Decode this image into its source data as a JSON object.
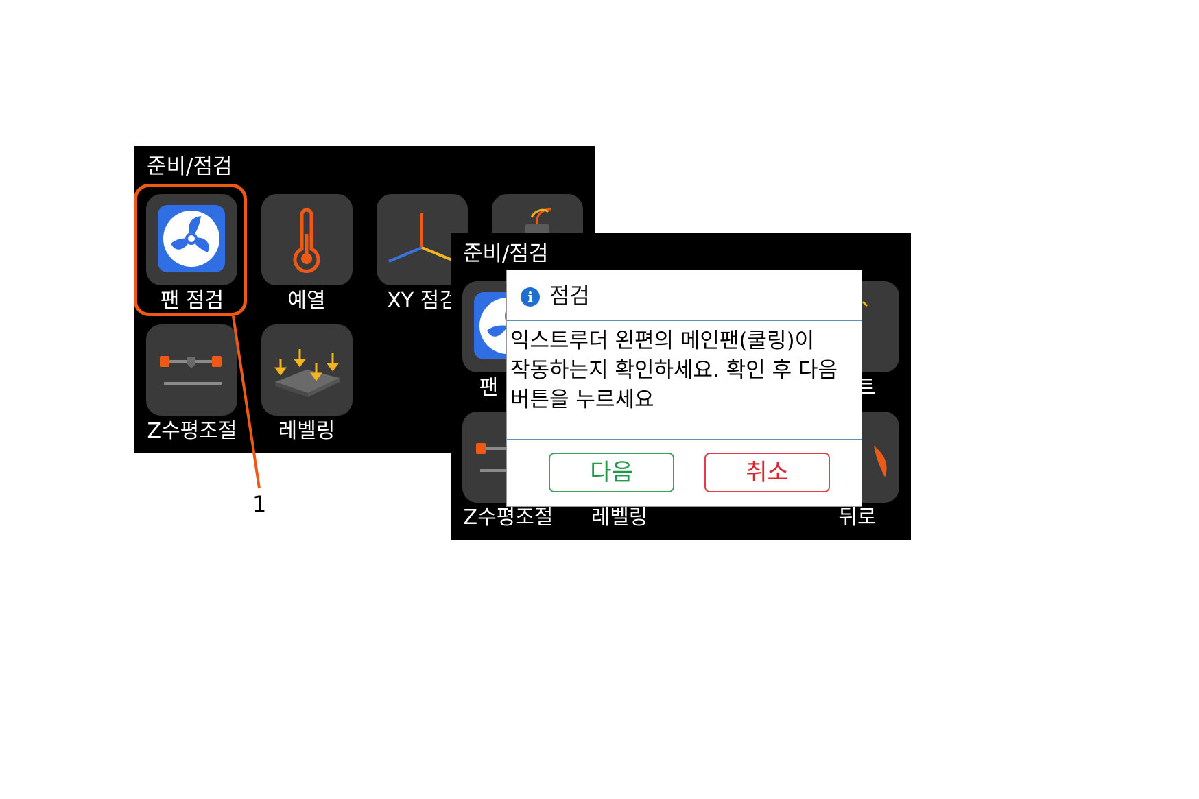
{
  "screen1": {
    "title": "준비/점검",
    "tiles": [
      {
        "label": "팬 점검",
        "icon": "fan-icon"
      },
      {
        "label": "예열",
        "icon": "thermometer-icon"
      },
      {
        "label": "XY 점검",
        "icon": "xy-axis-icon"
      },
      {
        "label": "",
        "icon": "filament-icon"
      },
      {
        "label": "Z수평조절",
        "icon": "z-level-icon"
      },
      {
        "label": "레벨링",
        "icon": "leveling-icon"
      }
    ]
  },
  "callout": {
    "number": "1",
    "color": "#ee5a16"
  },
  "screen2": {
    "title": "준비/점검",
    "visible_labels": [
      "팬 점",
      "Z수평조절",
      "레벨링",
      "센트",
      "뒤로"
    ]
  },
  "dialog": {
    "title": "점검",
    "info_glyph": "i",
    "message": "익스트루더 왼편의 메인팬(쿨링)이 작동하는지 확인하세요. 확인 후 다음 버튼을 누르세요",
    "next_label": "다음",
    "cancel_label": "취소"
  },
  "colors": {
    "screen_bg": "#000000",
    "tile_bg": "#3a3a3a",
    "fan_tile": "#2f6fe3",
    "accent_orange": "#ee5a16",
    "next_green": "#1e9a4a",
    "cancel_red": "#e0242f",
    "info_blue": "#1e6fd0"
  }
}
